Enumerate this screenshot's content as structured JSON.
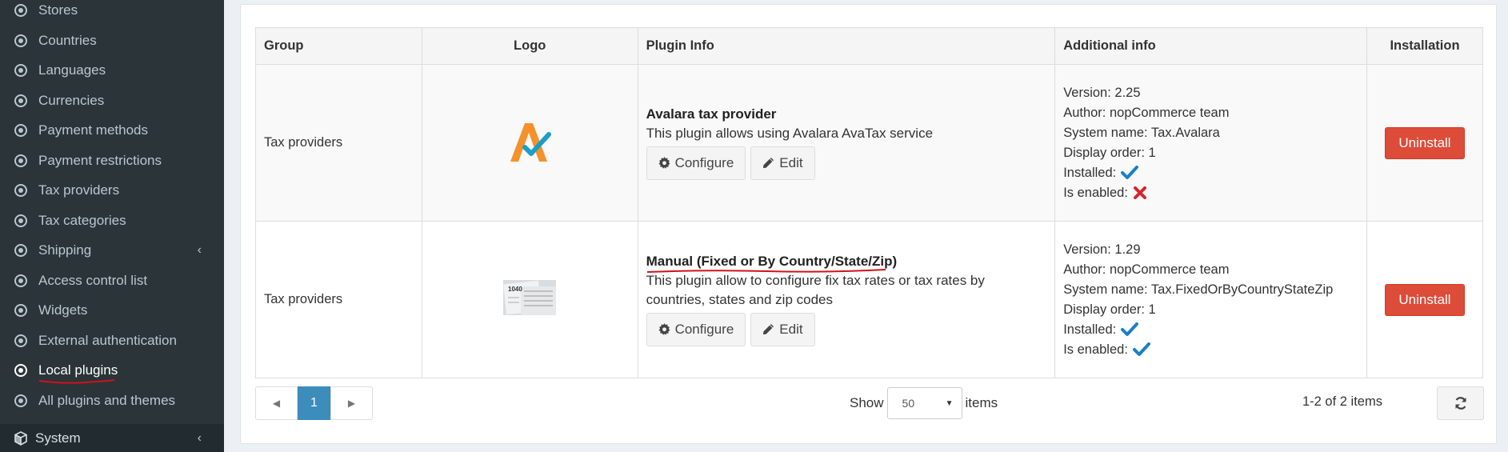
{
  "sidebar": {
    "items": [
      {
        "label": "Stores",
        "active": false
      },
      {
        "label": "Countries",
        "active": false
      },
      {
        "label": "Languages",
        "active": false
      },
      {
        "label": "Currencies",
        "active": false
      },
      {
        "label": "Payment methods",
        "active": false
      },
      {
        "label": "Payment restrictions",
        "active": false
      },
      {
        "label": "Tax providers",
        "active": false
      },
      {
        "label": "Tax categories",
        "active": false
      },
      {
        "label": "Shipping",
        "active": false,
        "has_submenu": true
      },
      {
        "label": "Access control list",
        "active": false
      },
      {
        "label": "Widgets",
        "active": false
      },
      {
        "label": "External authentication",
        "active": false
      },
      {
        "label": "Local plugins",
        "active": true
      },
      {
        "label": "All plugins and themes",
        "active": false
      }
    ],
    "system_label": "System"
  },
  "table": {
    "headers": [
      "Group",
      "Logo",
      "Plugin Info",
      "Additional info",
      "Installation"
    ],
    "rows": [
      {
        "group": "Tax providers",
        "logo_icon": "avalara-logo",
        "name": "Avalara tax provider",
        "description": "This plugin allows using Avalara AvaTax service",
        "configure_label": "Configure",
        "edit_label": "Edit",
        "version": "Version: 2.25",
        "author": "Author: nopCommerce team",
        "system_name": "System name: Tax.Avalara",
        "display_order": "Display order: 1",
        "installed_label": "Installed:",
        "installed": true,
        "enabled_label": "Is enabled:",
        "enabled": false,
        "uninstall_label": "Uninstall"
      },
      {
        "group": "Tax providers",
        "logo_icon": "tax-form-logo",
        "name": "Manual (Fixed or By Country/State/Zip)",
        "description": "This plugin allow to configure fix tax rates or tax rates by countries, states and zip codes",
        "configure_label": "Configure",
        "edit_label": "Edit",
        "version": "Version: 1.29",
        "author": "Author: nopCommerce team",
        "system_name": "System name: Tax.FixedOrByCountryStateZip",
        "display_order": "Display order: 1",
        "installed_label": "Installed:",
        "installed": true,
        "enabled_label": "Is enabled:",
        "enabled": true,
        "uninstall_label": "Uninstall"
      }
    ]
  },
  "pager": {
    "current_page": "1",
    "show_label": "Show",
    "page_size": "50",
    "items_label": "items",
    "range_info": "1-2 of 2 items"
  },
  "colors": {
    "sidebar_bg": "#2b3438",
    "accent": "#3c8dbc",
    "danger": "#dd4b39",
    "check": "#1a7fc9",
    "cross": "#d9232d",
    "annotation": "#d0121b"
  }
}
